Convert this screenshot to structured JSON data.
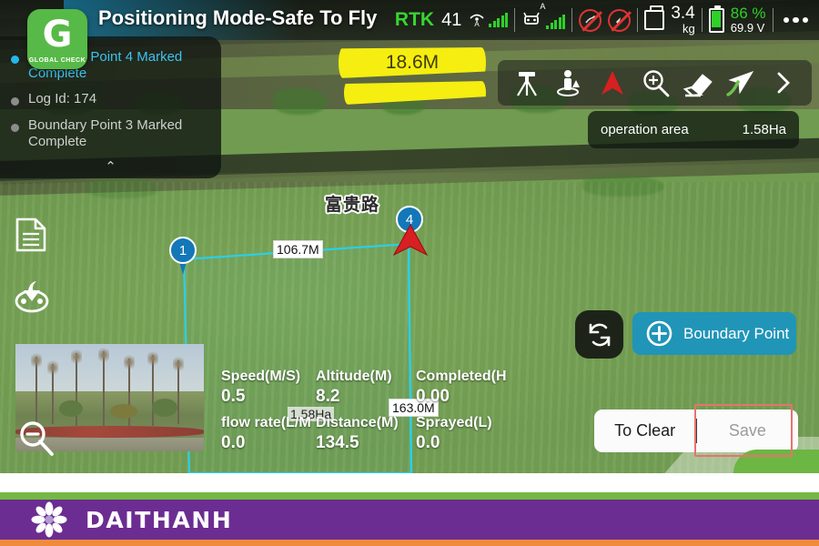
{
  "header": {
    "title": "Positioning Mode-Safe To Fly",
    "logo": {
      "letter": "G",
      "caption": "GLOBAL CHECK",
      "icon_name": "global-check-logo",
      "color": "#57b947"
    },
    "status": {
      "rtk_label": "RTK",
      "rtk_value": "41",
      "remote_signal_label": "A",
      "aircraft_signal_label": "A",
      "payload_weight": "3.4",
      "payload_unit": "kg",
      "battery_percent": "86 %",
      "battery_voltage": "69.9 V",
      "battery_color": "#2fd02a",
      "more_menu": "•••",
      "icons": [
        "remote-signal-icon",
        "aircraft-signal-icon",
        "no-spray-icon",
        "no-obstacle-avoidance-icon",
        "payload-tank-icon",
        "battery-icon",
        "more-options-icon"
      ]
    }
  },
  "log_panel": {
    "entries": [
      {
        "text": "Boundary Point 4 Marked Complete",
        "active": true
      },
      {
        "text": "Log Id: 174",
        "active": false
      },
      {
        "text": "Boundary Point 3 Marked Complete",
        "active": false
      }
    ],
    "collapse_icon": "⌃"
  },
  "toolbar": {
    "items": [
      {
        "name": "survey-tripod-icon",
        "label": "Survey Point"
      },
      {
        "name": "walk-survey-icon",
        "label": "Walk Survey"
      },
      {
        "name": "aircraft-position-icon",
        "label": "Aircraft Position"
      },
      {
        "name": "zoom-in-icon",
        "label": "Zoom In"
      },
      {
        "name": "eraser-icon",
        "label": "Erase"
      },
      {
        "name": "route-pointer-icon",
        "label": "Route"
      },
      {
        "name": "chevron-right-icon",
        "label": "More"
      }
    ]
  },
  "operation_area": {
    "label": "operation area",
    "value": "1.58Ha"
  },
  "left_rail": [
    {
      "name": "document-icon",
      "label": "Records"
    },
    {
      "name": "sprinkler-nozzle-icon",
      "label": "Spray Settings"
    },
    {
      "name": "zoom-out-icon",
      "label": "Zoom Out"
    }
  ],
  "map": {
    "highlight_distance": "18.6M",
    "road_name": "富贵路",
    "markers": [
      {
        "id": "1",
        "label": "1"
      },
      {
        "id": "4",
        "label": "4"
      }
    ],
    "aircraft_marker": "drone-heading-arrow",
    "edge_labels": [
      {
        "text": "106.7M"
      },
      {
        "text": "163.0M"
      }
    ],
    "area_badge": "1.58Ha",
    "boundary_color": "#2ad0e8"
  },
  "telemetry": {
    "rows": [
      [
        {
          "header": "Speed(M/S)",
          "value": "0.5"
        },
        {
          "header": "Altitude(M)",
          "value": "8.2"
        },
        {
          "header": "Completed(H",
          "value": "0.00"
        }
      ],
      [
        {
          "header": "flow rate(L/M",
          "value": "0.0"
        },
        {
          "header": "Distance(M)",
          "value": "134.5"
        },
        {
          "header": "Sprayed(L)",
          "value": "0.0"
        }
      ]
    ]
  },
  "controls": {
    "sync_icon": "refresh-sync-icon",
    "boundary_point_button": {
      "label": "Boundary Point",
      "icon": "plus-circle-icon",
      "color": "#2095b8"
    },
    "to_clear_button": "To Clear",
    "save_button": "Save",
    "save_highlight_color": "#e8736d"
  },
  "pip": {
    "name": "camera-feed-thumbnail",
    "timestamp": ""
  },
  "banner": {
    "brand": "DAITHANH",
    "logo_icon": "flower-logo-icon",
    "colors": {
      "green": "#74b844",
      "purple": "#6b2d91",
      "orange": "#f08a3c"
    }
  }
}
